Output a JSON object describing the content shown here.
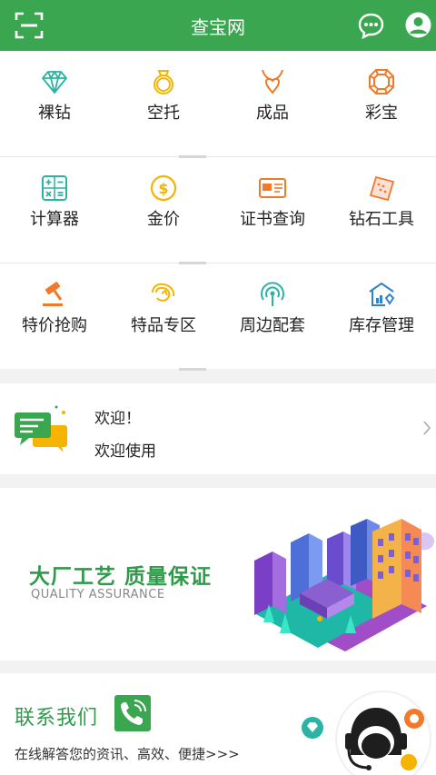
{
  "header": {
    "title": "查宝网",
    "left_icon": "scan-icon",
    "right_icons": [
      "chat-bubble-icon",
      "user-avatar-icon"
    ],
    "color": "#3aa650"
  },
  "grid": {
    "rows": [
      [
        {
          "label": "裸钻",
          "icon": "diamond-icon"
        },
        {
          "label": "空托",
          "icon": "ring-icon"
        },
        {
          "label": "成品",
          "icon": "necklace-icon"
        },
        {
          "label": "彩宝",
          "icon": "gemstone-icon"
        }
      ],
      [
        {
          "label": "计算器",
          "icon": "calculator-icon"
        },
        {
          "label": "金价",
          "icon": "gold-coin-icon"
        },
        {
          "label": "证书查询",
          "icon": "certificate-icon"
        },
        {
          "label": "钻石工具",
          "icon": "diamond-tool-icon"
        }
      ],
      [
        {
          "label": "特价抢购",
          "icon": "auction-hammer-icon"
        },
        {
          "label": "特品专区",
          "icon": "special-product-icon"
        },
        {
          "label": "周边配套",
          "icon": "signal-tower-icon"
        },
        {
          "label": "库存管理",
          "icon": "warehouse-icon"
        }
      ]
    ]
  },
  "welcome": {
    "title": "欢迎！",
    "subtitle": "欢迎使用",
    "icon": "message-bubbles-icon"
  },
  "banner": {
    "title": "大厂工艺 质量保证",
    "subtitle": "QUALITY ASSURANCE"
  },
  "contact": {
    "title": "联系我们",
    "subtitle": "在线解答您的资讯、高效、便捷>>>",
    "icon": "phone-icon"
  },
  "colors": {
    "brand_green": "#3aa650",
    "teal": "#2bb3a3",
    "orange": "#f07a2a",
    "yellow": "#f5b400"
  }
}
